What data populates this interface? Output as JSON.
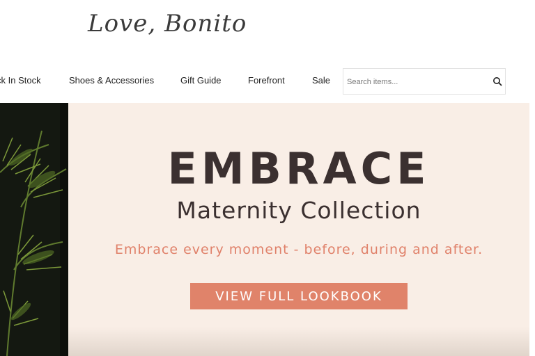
{
  "brand": {
    "logo_text": "Love, Bonito"
  },
  "nav": {
    "items": [
      {
        "label": "ck In Stock"
      },
      {
        "label": "Shoes & Accessories"
      },
      {
        "label": "Gift Guide"
      },
      {
        "label": "Forefront"
      },
      {
        "label": "Sale"
      }
    ]
  },
  "search": {
    "placeholder": "Search items...",
    "value": "",
    "icon": "search-icon"
  },
  "hero": {
    "title": "EMBRACE",
    "subtitle": "Maternity Collection",
    "tagline": "Embrace every moment - before, during and after.",
    "cta_label": "VIEW FULL LOOKBOOK",
    "image": "palm-plant-photo"
  },
  "colors": {
    "hero_background": "#f9eee6",
    "accent": "#e0836a",
    "title_text": "#3b3030"
  }
}
